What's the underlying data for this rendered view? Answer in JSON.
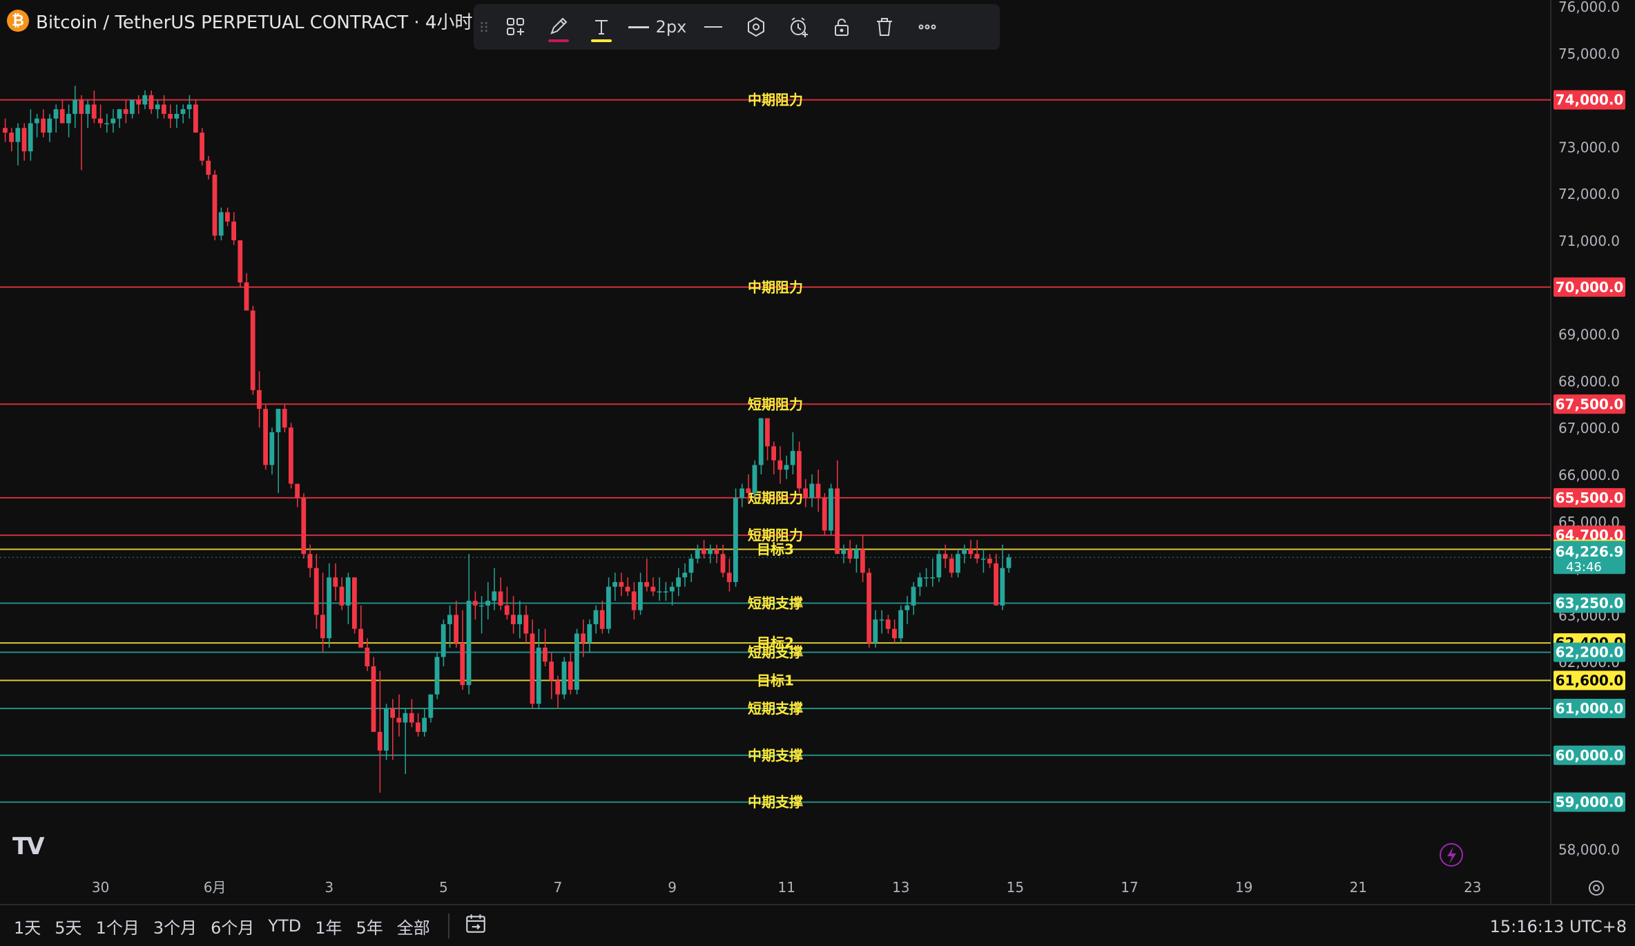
{
  "header": {
    "symbol": "Bitcoin / TetherUS PERPETUAL CONTRACT · 4小时 ·",
    "coin_icon": "bitcoin-icon"
  },
  "toolbar": {
    "width_label": "2px",
    "pencil_color": "#f23645",
    "text_color": "#ffeb3b"
  },
  "bottom": {
    "ranges": [
      "1天",
      "5天",
      "1个月",
      "3个月",
      "6个月",
      "YTD",
      "1年",
      "5年",
      "全部"
    ],
    "time": "15:16:13 UTC+8"
  },
  "colors": {
    "up": "#26a69a",
    "down": "#f23645",
    "background": "#0f0f0f"
  },
  "chart_data": {
    "type": "candlestick",
    "ylim": [
      57600,
      76000
    ],
    "ytick_labels": [
      "76,000.0",
      "75,000.0",
      "74,000.0",
      "73,000.0",
      "72,000.0",
      "71,000.0",
      "70,000.0",
      "69,000.0",
      "68,000.0",
      "67,000.0",
      "66,000.0",
      "65,000.0",
      "64,000.0",
      "63,000.0",
      "62,000.0",
      "61,000.0",
      "60,000.0",
      "59,000.0",
      "58,000.0"
    ],
    "ytick_values": [
      76000,
      75000,
      74000,
      73000,
      72000,
      71000,
      70000,
      69000,
      68000,
      67000,
      66000,
      65000,
      64000,
      63000,
      62000,
      61000,
      60000,
      59000,
      58000
    ],
    "xtick_labels": [
      "30",
      "6月",
      "3",
      "5",
      "7",
      "9",
      "11",
      "13",
      "15",
      "17",
      "19",
      "21",
      "23"
    ],
    "xtick_bars": [
      15,
      33,
      51,
      69,
      87,
      105,
      123,
      141,
      159,
      177,
      195,
      213,
      231
    ],
    "current_price": "64,226.9",
    "countdown": "43:46",
    "current_value": 64226.9,
    "levels": [
      {
        "label": "中期阻力",
        "value": 74000,
        "price": "74,000.0",
        "color": "#f23645"
      },
      {
        "label": "中期阻力",
        "value": 70000,
        "price": "70,000.0",
        "color": "#f23645"
      },
      {
        "label": "短期阻力",
        "value": 67500,
        "price": "67,500.0",
        "color": "#f23645"
      },
      {
        "label": "短期阻力",
        "value": 65500,
        "price": "65,500.0",
        "color": "#f23645"
      },
      {
        "label": "短期阻力",
        "value": 64700,
        "price": "64,700.0",
        "color": "#f23645"
      },
      {
        "label": "目标3",
        "value": 64400,
        "price": "64,400.0",
        "color": "#ffeb3b"
      },
      {
        "label": "短期支撑",
        "value": 63250,
        "price": "63,250.0",
        "color": "#26a69a"
      },
      {
        "label": "目标2",
        "value": 62400,
        "price": "62,400.0",
        "color": "#ffeb3b"
      },
      {
        "label": "短期支撑",
        "value": 62200,
        "price": "62,200.0",
        "color": "#26a69a"
      },
      {
        "label": "目标1",
        "value": 61600,
        "price": "61,600.0",
        "color": "#ffeb3b"
      },
      {
        "label": "短期支撑",
        "value": 61000,
        "price": "61,000.0",
        "color": "#26a69a"
      },
      {
        "label": "中期支撑",
        "value": 60000,
        "price": "60,000.0",
        "color": "#26a69a"
      },
      {
        "label": "中期支撑",
        "value": 59000,
        "price": "59,000.0",
        "color": "#26a69a"
      }
    ],
    "candles": [
      [
        73400,
        73600,
        73100,
        73300
      ],
      [
        73300,
        73400,
        72900,
        73100
      ],
      [
        73100,
        73500,
        72600,
        73400
      ],
      [
        73400,
        73500,
        72700,
        72900
      ],
      [
        72900,
        73800,
        72700,
        73500
      ],
      [
        73500,
        73700,
        73200,
        73600
      ],
      [
        73600,
        73800,
        73200,
        73300
      ],
      [
        73300,
        73700,
        73100,
        73600
      ],
      [
        73600,
        73900,
        73300,
        73800
      ],
      [
        73800,
        74000,
        73500,
        73500
      ],
      [
        73500,
        73900,
        73200,
        73700
      ],
      [
        73700,
        74300,
        73400,
        74000
      ],
      [
        74000,
        74100,
        72500,
        73700
      ],
      [
        73700,
        74000,
        73400,
        73900
      ],
      [
        73900,
        74200,
        73500,
        73600
      ],
      [
        73600,
        73900,
        73400,
        73500
      ],
      [
        73500,
        73700,
        73300,
        73500
      ],
      [
        73500,
        73800,
        73300,
        73600
      ],
      [
        73600,
        73800,
        73400,
        73800
      ],
      [
        73800,
        74000,
        73500,
        73700
      ],
      [
        73700,
        74000,
        73600,
        74000
      ],
      [
        74000,
        74100,
        73700,
        73900
      ],
      [
        73900,
        74200,
        73800,
        74100
      ],
      [
        74100,
        74200,
        73700,
        73800
      ],
      [
        73800,
        74000,
        73600,
        73900
      ],
      [
        73900,
        74100,
        73600,
        73700
      ],
      [
        73700,
        73900,
        73400,
        73600
      ],
      [
        73600,
        73900,
        73400,
        73700
      ],
      [
        73700,
        73900,
        73500,
        73800
      ],
      [
        73800,
        74100,
        73600,
        73900
      ],
      [
        73900,
        74000,
        73300,
        73300
      ],
      [
        73300,
        73400,
        72600,
        72700
      ],
      [
        72700,
        72800,
        72300,
        72400
      ],
      [
        72400,
        72500,
        71000,
        71100
      ],
      [
        71100,
        71700,
        71000,
        71600
      ],
      [
        71600,
        71700,
        71300,
        71400
      ],
      [
        71400,
        71600,
        70900,
        71000
      ],
      [
        71000,
        71000,
        70000,
        70100
      ],
      [
        70100,
        70300,
        69500,
        69500
      ],
      [
        69500,
        69600,
        67700,
        67800
      ],
      [
        67800,
        68200,
        67000,
        67400
      ],
      [
        67400,
        67500,
        66100,
        66200
      ],
      [
        66200,
        67000,
        66000,
        66900
      ],
      [
        66900,
        67300,
        65600,
        67400
      ],
      [
        67400,
        67500,
        66900,
        67000
      ],
      [
        67000,
        67100,
        65700,
        65800
      ],
      [
        65800,
        65800,
        65300,
        65500
      ],
      [
        65500,
        65600,
        64200,
        64300
      ],
      [
        64300,
        64500,
        63800,
        64000
      ],
      [
        64000,
        64300,
        62700,
        63000
      ],
      [
        63000,
        63900,
        62200,
        62500
      ],
      [
        62500,
        64100,
        62300,
        63800
      ],
      [
        63800,
        64100,
        63300,
        63600
      ],
      [
        63600,
        63800,
        63100,
        63200
      ],
      [
        63200,
        63900,
        62800,
        63800
      ],
      [
        63800,
        63800,
        62600,
        62700
      ],
      [
        62700,
        63200,
        62300,
        62300
      ],
      [
        62300,
        62500,
        61800,
        61900
      ],
      [
        61900,
        62100,
        60500,
        60500
      ],
      [
        60500,
        61800,
        59200,
        60100
      ],
      [
        60100,
        61100,
        59900,
        61000
      ],
      [
        61000,
        61200,
        59900,
        60800
      ],
      [
        60800,
        61300,
        60400,
        60700
      ],
      [
        60700,
        61000,
        59600,
        60900
      ],
      [
        60900,
        61200,
        60600,
        60700
      ],
      [
        60700,
        60900,
        60400,
        60500
      ],
      [
        60500,
        61000,
        60400,
        60800
      ],
      [
        60800,
        61300,
        60700,
        61300
      ],
      [
        61300,
        62200,
        61200,
        62100
      ],
      [
        62100,
        62900,
        61900,
        62800
      ],
      [
        62800,
        63200,
        62300,
        63000
      ],
      [
        63000,
        63300,
        62300,
        62400
      ],
      [
        62400,
        63100,
        61400,
        61500
      ],
      [
        61500,
        64300,
        61300,
        63300
      ],
      [
        63300,
        63500,
        62900,
        63200
      ],
      [
        63200,
        63400,
        62600,
        63200
      ],
      [
        63200,
        63700,
        62900,
        63300
      ],
      [
        63300,
        64000,
        63100,
        63500
      ],
      [
        63500,
        63800,
        63100,
        63200
      ],
      [
        63200,
        63600,
        62900,
        63000
      ],
      [
        63000,
        63400,
        62600,
        62800
      ],
      [
        62800,
        63300,
        62500,
        63000
      ],
      [
        63000,
        63200,
        62400,
        62600
      ],
      [
        62600,
        62900,
        61000,
        61100
      ],
      [
        61100,
        62700,
        61000,
        62300
      ],
      [
        62300,
        62700,
        61900,
        62000
      ],
      [
        62000,
        62200,
        61200,
        61600
      ],
      [
        61600,
        61700,
        61000,
        61300
      ],
      [
        61300,
        62100,
        61200,
        62000
      ],
      [
        62000,
        62200,
        61300,
        61400
      ],
      [
        61400,
        62700,
        61300,
        62600
      ],
      [
        62600,
        62900,
        62100,
        62400
      ],
      [
        62400,
        62900,
        62200,
        62800
      ],
      [
        62800,
        63200,
        62600,
        63100
      ],
      [
        63100,
        63300,
        62600,
        62700
      ],
      [
        62700,
        63800,
        62600,
        63600
      ],
      [
        63600,
        63900,
        63300,
        63700
      ],
      [
        63700,
        63900,
        63400,
        63600
      ],
      [
        63600,
        63800,
        63400,
        63500
      ],
      [
        63500,
        63700,
        62900,
        63100
      ],
      [
        63100,
        63900,
        63000,
        63700
      ],
      [
        63700,
        64200,
        63500,
        63600
      ],
      [
        63600,
        63800,
        63400,
        63500
      ],
      [
        63500,
        63800,
        63300,
        63500
      ],
      [
        63500,
        63700,
        63300,
        63500
      ],
      [
        63500,
        63700,
        63200,
        63600
      ],
      [
        63600,
        64000,
        63400,
        63800
      ],
      [
        63800,
        64100,
        63600,
        63900
      ],
      [
        63900,
        64300,
        63700,
        64200
      ],
      [
        64200,
        64500,
        64100,
        64400
      ],
      [
        64400,
        64600,
        64200,
        64300
      ],
      [
        64300,
        64500,
        64100,
        64400
      ],
      [
        64400,
        64500,
        64100,
        64300
      ],
      [
        64300,
        64500,
        63800,
        63900
      ],
      [
        63900,
        64200,
        63500,
        63700
      ],
      [
        63700,
        65700,
        63600,
        65500
      ],
      [
        65500,
        65800,
        65300,
        65700
      ],
      [
        65700,
        66000,
        65400,
        65600
      ],
      [
        65600,
        66300,
        65500,
        66200
      ],
      [
        66200,
        67200,
        66000,
        67200
      ],
      [
        67200,
        67200,
        66300,
        66600
      ],
      [
        66600,
        66700,
        66000,
        66300
      ],
      [
        66300,
        66600,
        65800,
        66100
      ],
      [
        66100,
        66400,
        65900,
        66200
      ],
      [
        66200,
        66900,
        66000,
        66500
      ],
      [
        66500,
        66700,
        65600,
        65700
      ],
      [
        65700,
        65900,
        65300,
        65500
      ],
      [
        65500,
        66000,
        65300,
        65800
      ],
      [
        65800,
        66100,
        65200,
        65500
      ],
      [
        65500,
        65600,
        64700,
        64800
      ],
      [
        64800,
        65800,
        64700,
        65700
      ],
      [
        65700,
        66300,
        64300,
        64300
      ],
      [
        64300,
        64500,
        64100,
        64400
      ],
      [
        64400,
        64600,
        64100,
        64200
      ],
      [
        64200,
        64500,
        63900,
        64400
      ],
      [
        64400,
        64700,
        63700,
        63900
      ],
      [
        63900,
        64000,
        62300,
        62400
      ],
      [
        62400,
        63100,
        62300,
        62900
      ],
      [
        62900,
        63100,
        62600,
        62900
      ],
      [
        62900,
        63000,
        62600,
        62700
      ],
      [
        62700,
        62900,
        62400,
        62500
      ],
      [
        62500,
        63200,
        62400,
        63100
      ],
      [
        63100,
        63400,
        62800,
        63200
      ],
      [
        63200,
        63700,
        63000,
        63600
      ],
      [
        63600,
        63900,
        63400,
        63800
      ],
      [
        63800,
        64000,
        63600,
        63800
      ],
      [
        63800,
        64200,
        63600,
        63800
      ],
      [
        63800,
        64400,
        63700,
        64300
      ],
      [
        64300,
        64500,
        64000,
        64200
      ],
      [
        64200,
        64300,
        63800,
        63900
      ],
      [
        63900,
        64400,
        63800,
        64300
      ],
      [
        64300,
        64500,
        64100,
        64400
      ],
      [
        64400,
        64600,
        64200,
        64300
      ],
      [
        64300,
        64600,
        64100,
        64200
      ],
      [
        64200,
        64400,
        63900,
        64200
      ],
      [
        64200,
        64300,
        64000,
        64100
      ],
      [
        64100,
        64300,
        63200,
        63200
      ],
      [
        63200,
        64500,
        63100,
        64000
      ],
      [
        64000,
        64300,
        63900,
        64226.9
      ]
    ]
  }
}
